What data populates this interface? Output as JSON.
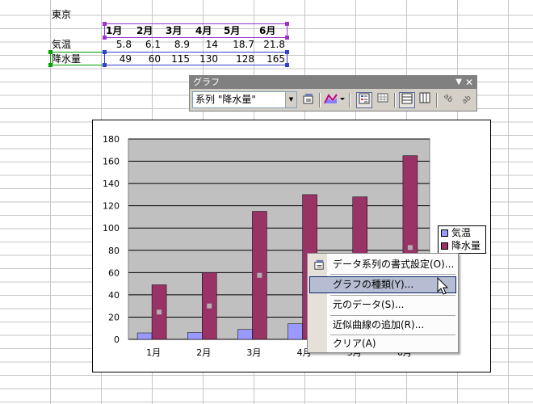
{
  "sheet": {
    "title_cell": "東京",
    "months": [
      "1月",
      "2月",
      "3月",
      "4月",
      "5月",
      "6月"
    ],
    "rows": [
      {
        "label": "気温",
        "values": [
          "5.8",
          "6.1",
          "8.9",
          "14",
          "18.7",
          "21.8"
        ]
      },
      {
        "label": "降水量",
        "values": [
          "49",
          "60",
          "115",
          "130",
          "128",
          "165"
        ]
      }
    ]
  },
  "toolbar": {
    "title": "グラフ",
    "series_select": "系列 \"降水量\"",
    "buttons": [
      "format-series-icon",
      "chart-type-icon",
      "legend-icon",
      "data-table-icon",
      "by-row-icon",
      "by-column-icon",
      "angle-text-down-icon",
      "angle-text-up-icon"
    ]
  },
  "chart_data": {
    "type": "bar",
    "categories": [
      "1月",
      "2月",
      "3月",
      "4月",
      "5月",
      "6月"
    ],
    "series": [
      {
        "name": "気温",
        "values": [
          5.8,
          6.1,
          8.9,
          14,
          18.7,
          21.8
        ],
        "color": "#9999ff"
      },
      {
        "name": "降水量",
        "values": [
          49,
          60,
          115,
          130,
          128,
          165
        ],
        "color": "#993366"
      }
    ],
    "ylim": [
      0,
      180
    ],
    "yticks": [
      "0",
      "20",
      "40",
      "60",
      "80",
      "100",
      "120",
      "140",
      "160",
      "180"
    ],
    "plot_background": "#c0c0c0",
    "grid": true,
    "legend_position": "right"
  },
  "context_menu": {
    "items": [
      "データ系列の書式設定(O)...",
      "グラフの種類(Y)...",
      "元のデータ(S)...",
      "近似曲線の追加(R)...",
      "クリア(A)"
    ],
    "highlighted_index": 1
  }
}
